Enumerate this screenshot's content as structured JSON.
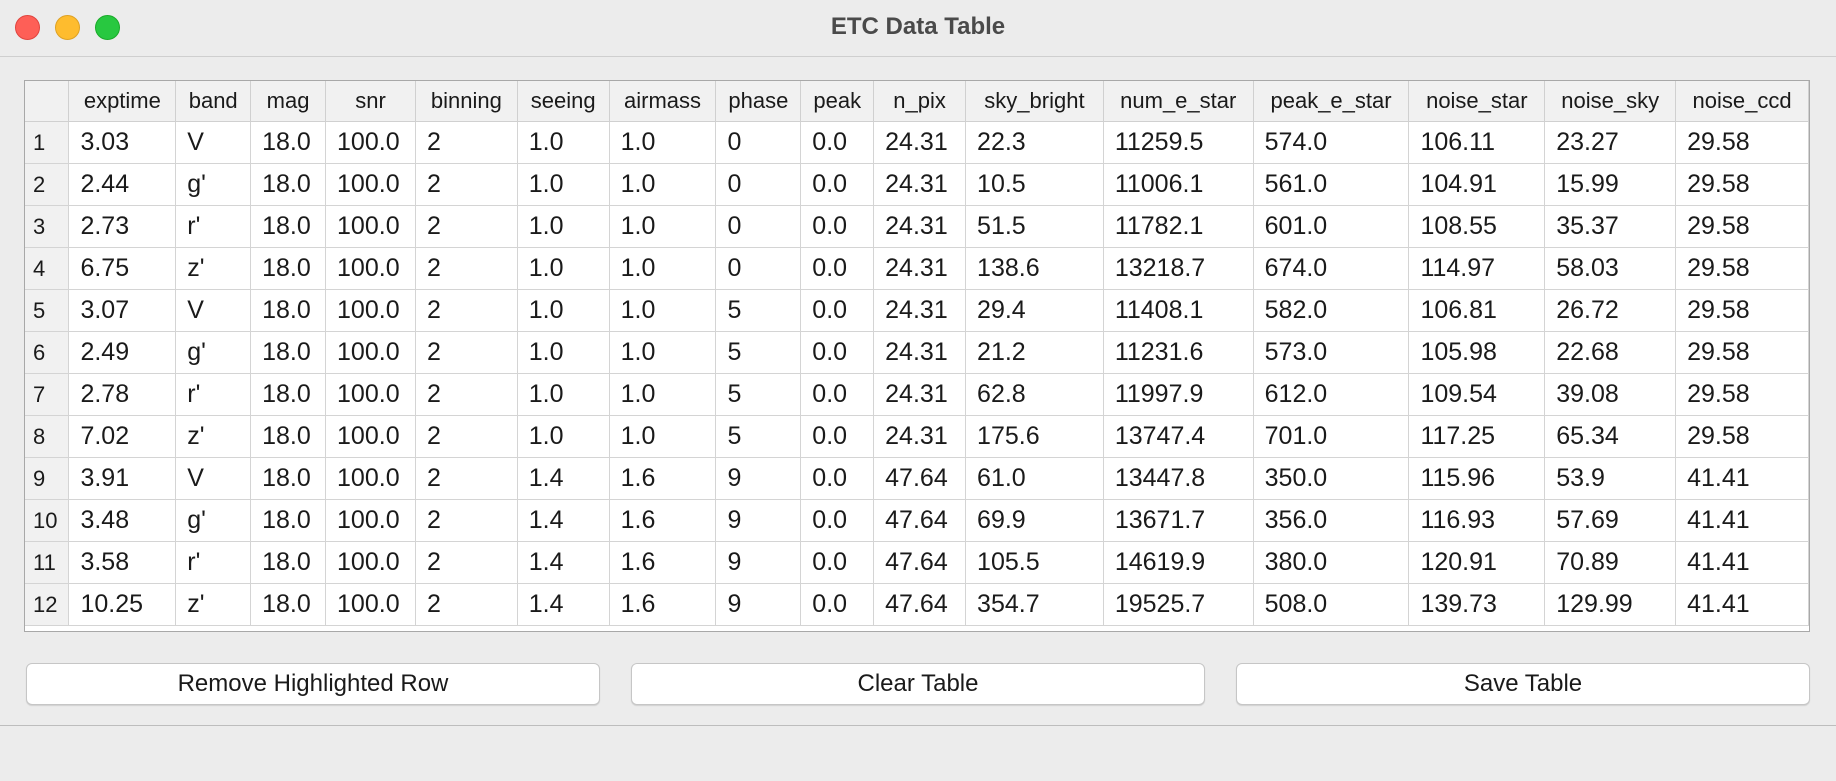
{
  "window": {
    "title": "ETC Data Table"
  },
  "table": {
    "columns": [
      "exptime",
      "band",
      "mag",
      "snr",
      "binning",
      "seeing",
      "airmass",
      "phase",
      "peak",
      "n_pix",
      "sky_bright",
      "num_e_star",
      "peak_e_star",
      "noise_star",
      "noise_sky",
      "noise_ccd"
    ],
    "rows": [
      {
        "index": "1",
        "cells": [
          "3.03",
          "V",
          "18.0",
          "100.0",
          "2",
          "1.0",
          "1.0",
          "0",
          "0.0",
          "24.31",
          "22.3",
          "11259.5",
          "574.0",
          "106.11",
          "23.27",
          "29.58"
        ]
      },
      {
        "index": "2",
        "cells": [
          "2.44",
          "g'",
          "18.0",
          "100.0",
          "2",
          "1.0",
          "1.0",
          "0",
          "0.0",
          "24.31",
          "10.5",
          "11006.1",
          "561.0",
          "104.91",
          "15.99",
          "29.58"
        ]
      },
      {
        "index": "3",
        "cells": [
          "2.73",
          "r'",
          "18.0",
          "100.0",
          "2",
          "1.0",
          "1.0",
          "0",
          "0.0",
          "24.31",
          "51.5",
          "11782.1",
          "601.0",
          "108.55",
          "35.37",
          "29.58"
        ]
      },
      {
        "index": "4",
        "cells": [
          "6.75",
          "z'",
          "18.0",
          "100.0",
          "2",
          "1.0",
          "1.0",
          "0",
          "0.0",
          "24.31",
          "138.6",
          "13218.7",
          "674.0",
          "114.97",
          "58.03",
          "29.58"
        ]
      },
      {
        "index": "5",
        "cells": [
          "3.07",
          "V",
          "18.0",
          "100.0",
          "2",
          "1.0",
          "1.0",
          "5",
          "0.0",
          "24.31",
          "29.4",
          "11408.1",
          "582.0",
          "106.81",
          "26.72",
          "29.58"
        ]
      },
      {
        "index": "6",
        "cells": [
          "2.49",
          "g'",
          "18.0",
          "100.0",
          "2",
          "1.0",
          "1.0",
          "5",
          "0.0",
          "24.31",
          "21.2",
          "11231.6",
          "573.0",
          "105.98",
          "22.68",
          "29.58"
        ]
      },
      {
        "index": "7",
        "cells": [
          "2.78",
          "r'",
          "18.0",
          "100.0",
          "2",
          "1.0",
          "1.0",
          "5",
          "0.0",
          "24.31",
          "62.8",
          "11997.9",
          "612.0",
          "109.54",
          "39.08",
          "29.58"
        ]
      },
      {
        "index": "8",
        "cells": [
          "7.02",
          "z'",
          "18.0",
          "100.0",
          "2",
          "1.0",
          "1.0",
          "5",
          "0.0",
          "24.31",
          "175.6",
          "13747.4",
          "701.0",
          "117.25",
          "65.34",
          "29.58"
        ]
      },
      {
        "index": "9",
        "cells": [
          "3.91",
          "V",
          "18.0",
          "100.0",
          "2",
          "1.4",
          "1.6",
          "9",
          "0.0",
          "47.64",
          "61.0",
          "13447.8",
          "350.0",
          "115.96",
          "53.9",
          "41.41"
        ]
      },
      {
        "index": "10",
        "cells": [
          "3.48",
          "g'",
          "18.0",
          "100.0",
          "2",
          "1.4",
          "1.6",
          "9",
          "0.0",
          "47.64",
          "69.9",
          "13671.7",
          "356.0",
          "116.93",
          "57.69",
          "41.41"
        ]
      },
      {
        "index": "11",
        "cells": [
          "3.58",
          "r'",
          "18.0",
          "100.0",
          "2",
          "1.4",
          "1.6",
          "9",
          "0.0",
          "47.64",
          "105.5",
          "14619.9",
          "380.0",
          "120.91",
          "70.89",
          "41.41"
        ]
      },
      {
        "index": "12",
        "cells": [
          "10.25",
          "z'",
          "18.0",
          "100.0",
          "2",
          "1.4",
          "1.6",
          "9",
          "0.0",
          "47.64",
          "354.7",
          "19525.7",
          "508.0",
          "139.73",
          "129.99",
          "41.41"
        ]
      }
    ]
  },
  "buttons": {
    "remove": "Remove Highlighted Row",
    "clear": "Clear Table",
    "save": "Save Table"
  }
}
